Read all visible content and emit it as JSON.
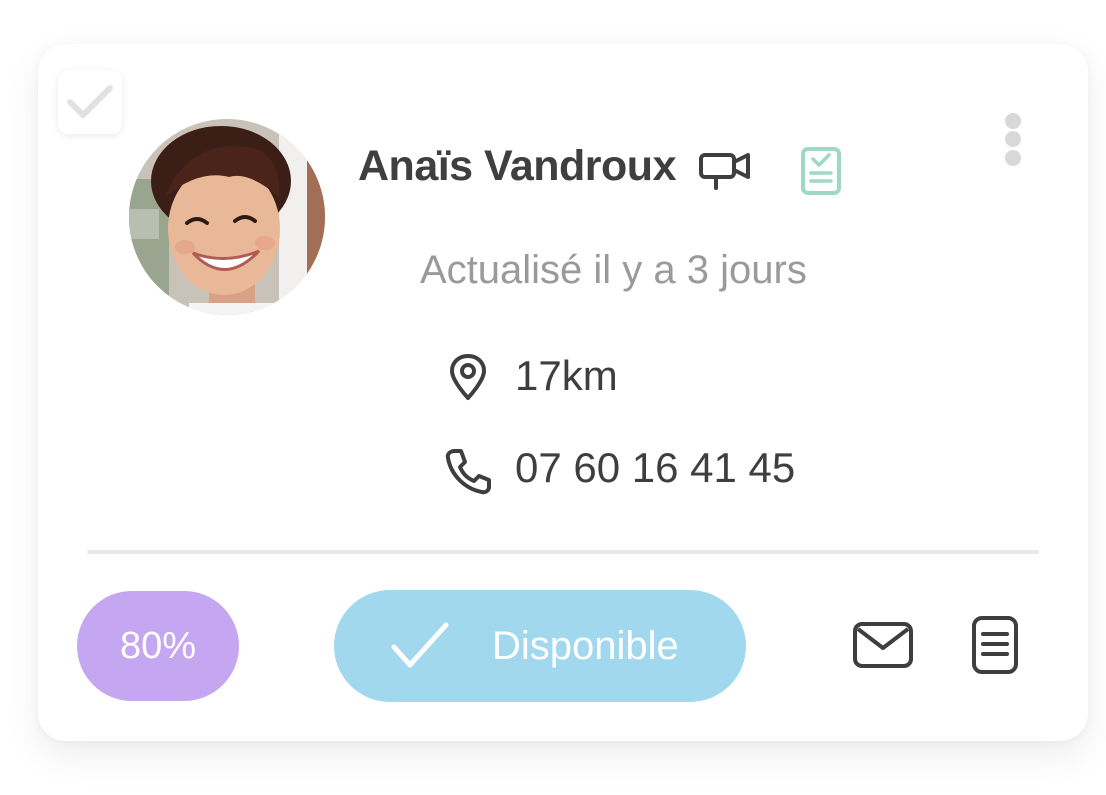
{
  "candidate": {
    "name": "Anaïs Vandroux",
    "updated": "Actualisé il y a 3 jours",
    "distance": "17km",
    "phone": "07 60 16 41 45",
    "match_score": "80%",
    "status_label": "Disponible"
  },
  "icons": {
    "select": "checkmark-icon",
    "video": "video-camera-icon",
    "document": "document-check-icon",
    "more": "more-vertical-icon",
    "location": "location-pin-icon",
    "phone": "phone-icon",
    "status": "checkmark-icon",
    "mail": "mail-icon",
    "notes": "notes-icon"
  },
  "colors": {
    "score_badge": "#c5a6f1",
    "status_button": "#a1d8ee",
    "document_icon": "#9fd9c3",
    "text_primary": "#3f3f3f",
    "text_secondary": "#9a9a9a"
  }
}
